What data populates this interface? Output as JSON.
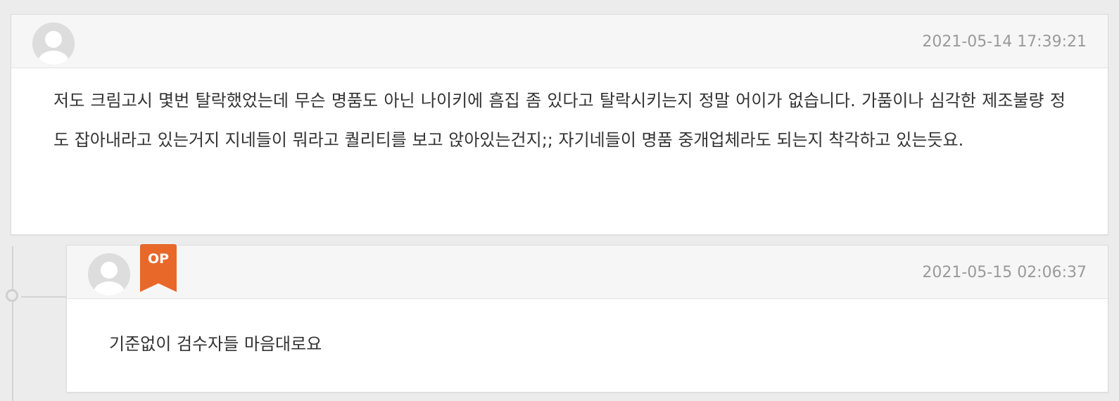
{
  "comments": [
    {
      "timestamp": "2021-05-14 17:39:21",
      "avatar_icon": "default-user-avatar-icon",
      "text": " 저도 크림고시 몇번 탈락했었는데 무슨 명품도 아닌 나이키에 흠집 좀 있다고 탈락시키는지 정말 어이가 없습니다. 가품이나 심각한 제조불량 정도 잡아내라고 있는거지 지네들이 뭐라고 퀄리티를 보고 앉아있는건지;; 자기네들이 명품 중개업체라도 되는지 착각하고 있는듯요."
    },
    {
      "timestamp": "2021-05-15 02:06:37",
      "avatar_icon": "default-user-avatar-icon",
      "badge": "OP",
      "badge_color": "#e8682a",
      "text": "기준없이 검수자들 마음대로요"
    }
  ]
}
